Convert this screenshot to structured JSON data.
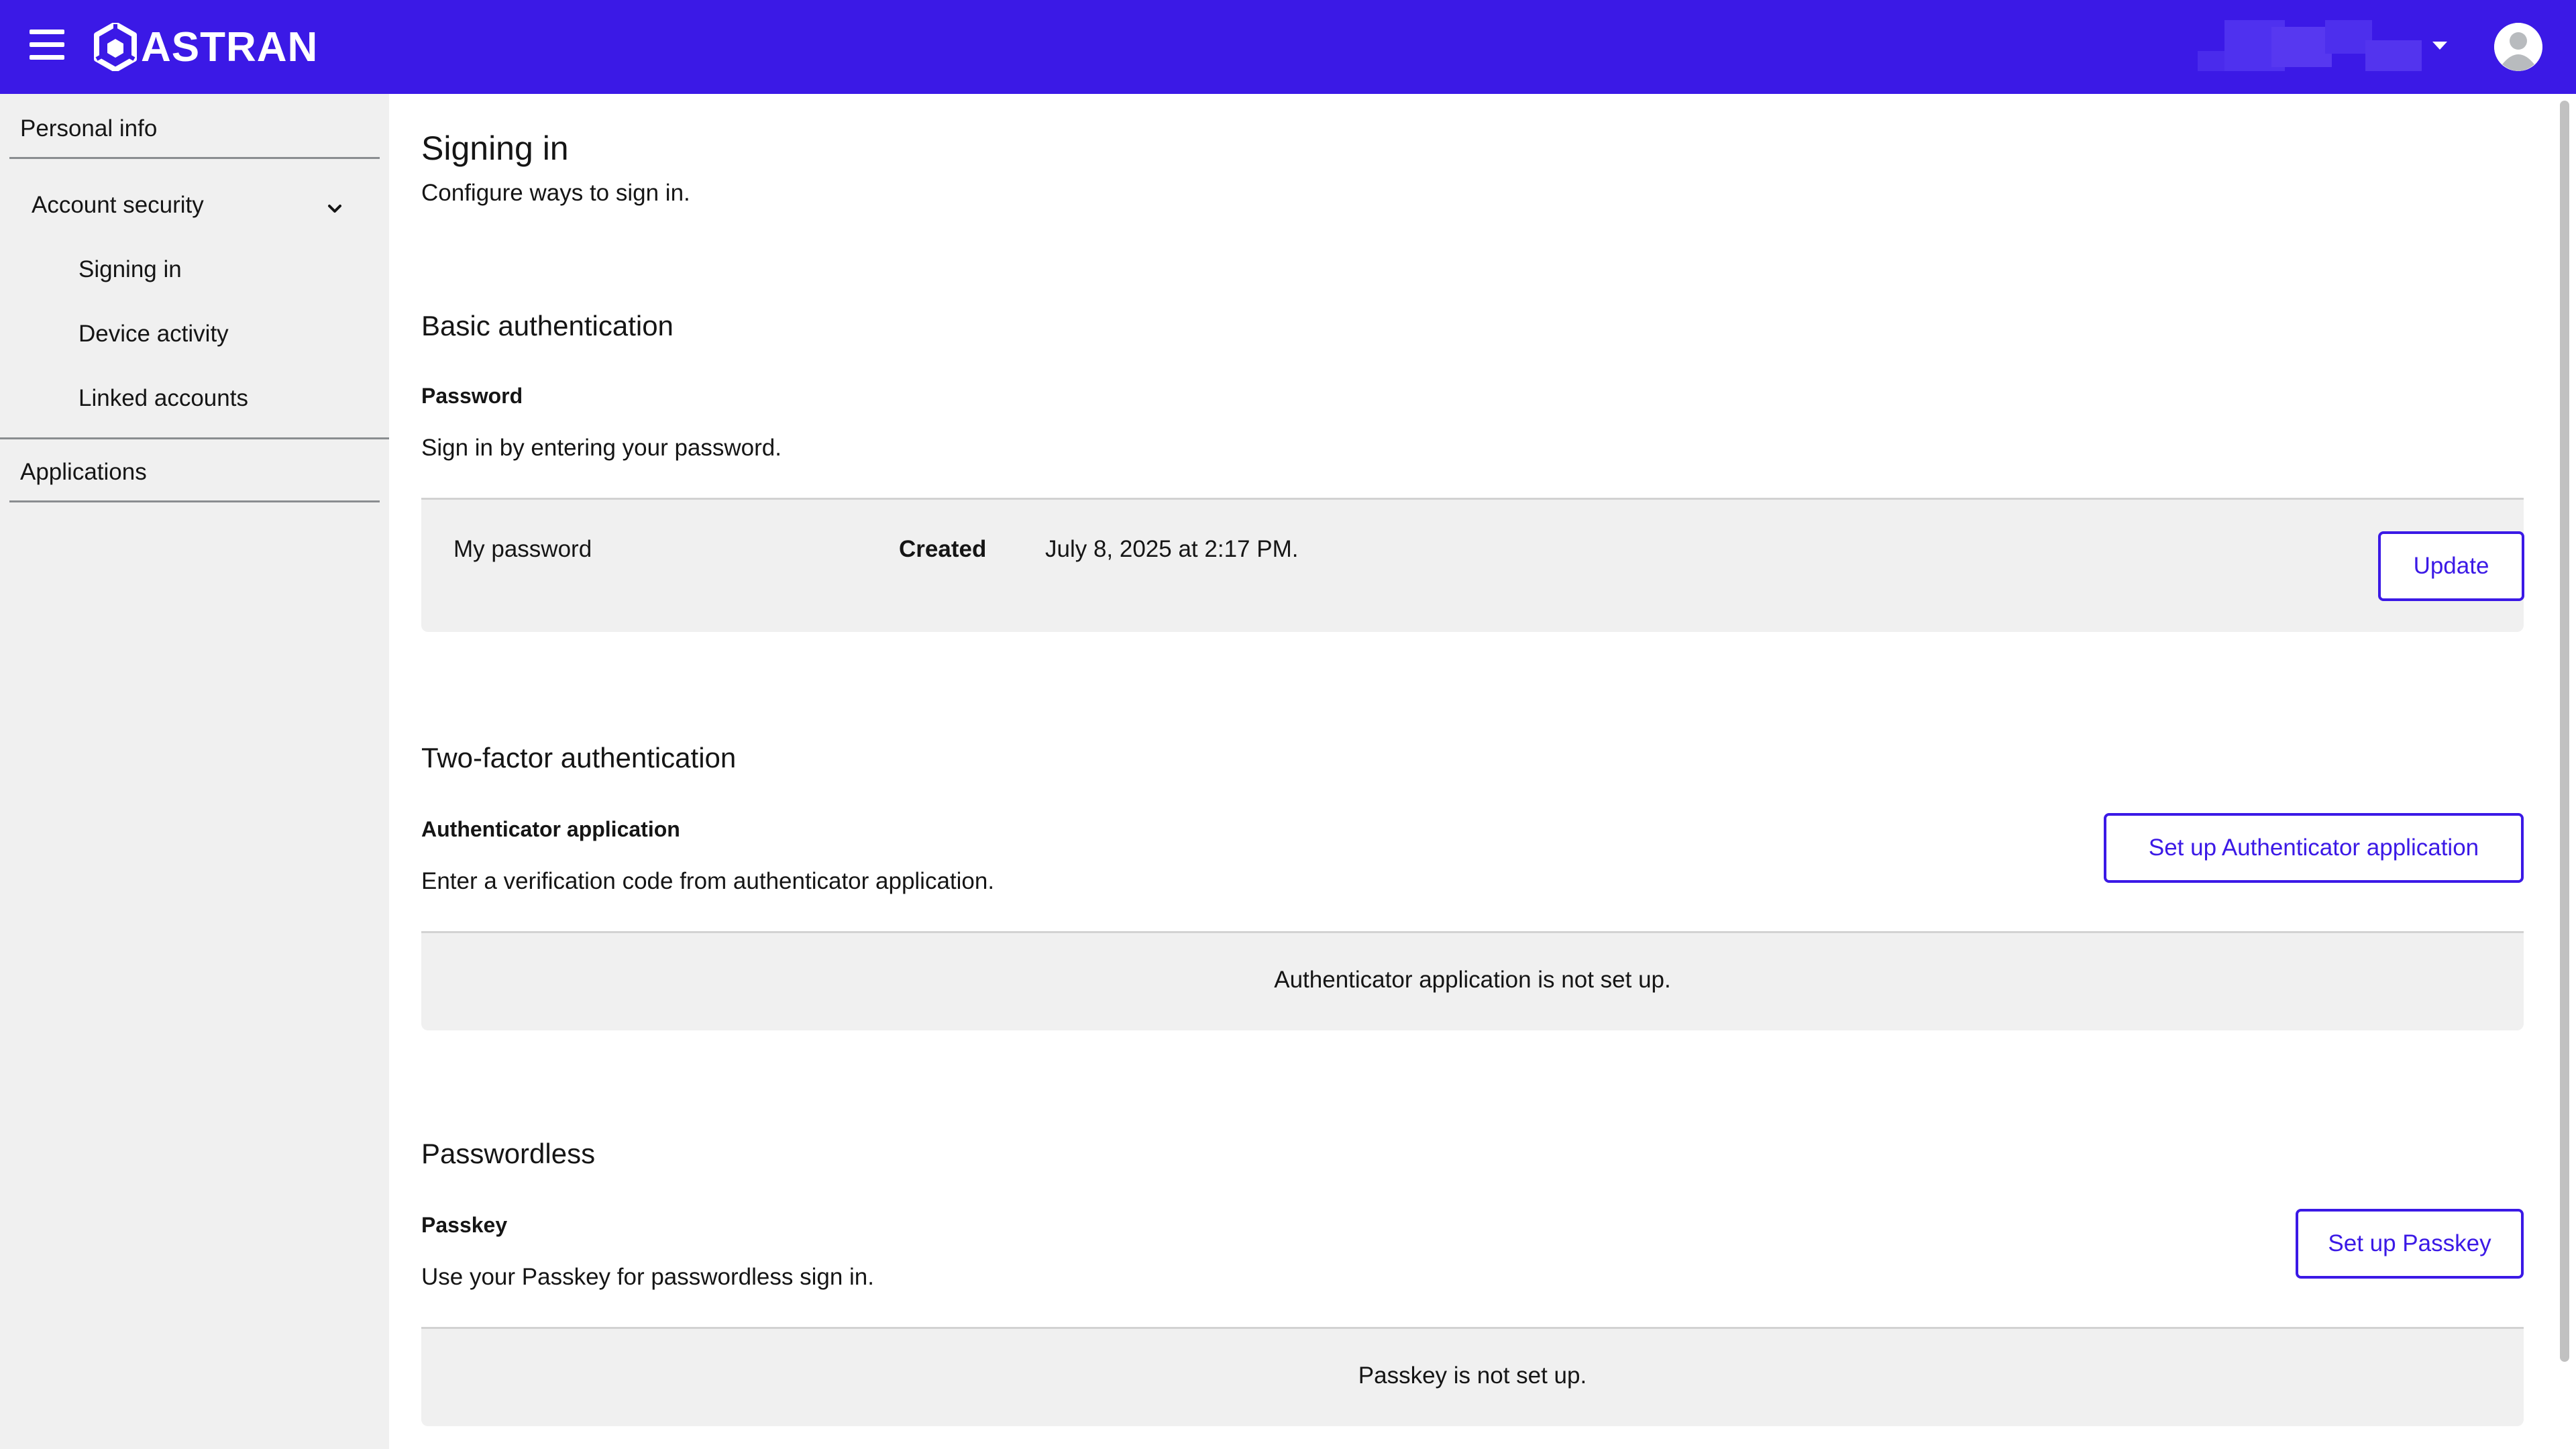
{
  "header": {
    "brand": "ASTRAN",
    "colors": {
      "primary": "#3b19e6",
      "header_text": "#ffffff"
    },
    "icons": {
      "menu": "hamburger-menu-icon",
      "logo": "astran-logo-icon",
      "account": "user-avatar-icon",
      "dropdown": "caret-down-icon"
    }
  },
  "sidebar": {
    "personal_info": "Personal info",
    "account_security": "Account security",
    "sub_items": [
      "Signing in",
      "Device activity",
      "Linked accounts"
    ],
    "applications": "Applications"
  },
  "main": {
    "title": "Signing in",
    "subtitle": "Configure ways to sign in.",
    "basic": {
      "heading": "Basic authentication",
      "label": "Password",
      "description": "Sign in by entering your password.",
      "row_name": "My password",
      "created_label": "Created",
      "created_value": "July 8, 2025 at 2:17 PM.",
      "button": "Update"
    },
    "two_factor": {
      "heading": "Two-factor authentication",
      "label": "Authenticator application",
      "description": "Enter a verification code from authenticator application.",
      "button": "Set up Authenticator application",
      "empty": "Authenticator application is not set up."
    },
    "passwordless": {
      "heading": "Passwordless",
      "label": "Passkey",
      "description": "Use your Passkey for passwordless sign in.",
      "button": "Set up Passkey",
      "empty": "Passkey is not set up."
    }
  }
}
